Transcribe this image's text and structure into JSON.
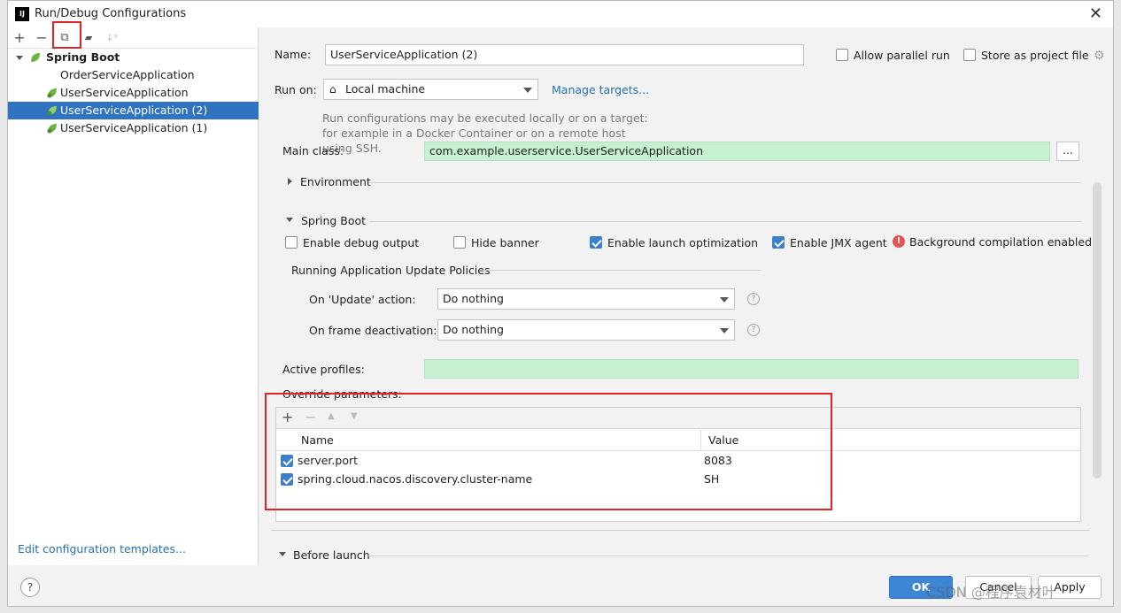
{
  "window": {
    "title": "Run/Debug Configurations",
    "logo_text": "IJ"
  },
  "toolbar": {
    "add": "+",
    "remove": "−",
    "copy": "⧉",
    "folder": "▰",
    "sort": "↓ᵃ"
  },
  "tree": {
    "group": "Spring Boot",
    "items": [
      "OrderServiceApplication",
      "UserServiceApplication",
      "UserServiceApplication (2)",
      "UserServiceApplication (1)"
    ],
    "selected_index": 2
  },
  "left_footer": {
    "edit_templates": "Edit configuration templates..."
  },
  "form": {
    "name_label": "Name:",
    "name_value": "UserServiceApplication (2)",
    "allow_parallel": "Allow parallel run",
    "store_project_file": "Store as project file",
    "run_on_label": "Run on:",
    "run_on_value": "Local machine",
    "manage_targets": "Manage targets...",
    "run_on_hint": "Run configurations may be executed locally or on a target: for example in a Docker Container or on a remote host using SSH.",
    "main_class_label": "Main class:",
    "main_class_value": "com.example.userservice.UserServiceApplication",
    "dots": "...",
    "environment": "Environment",
    "spring_boot_section": "Spring Boot",
    "enable_debug_output": "Enable debug output",
    "hide_banner": "Hide banner",
    "enable_launch_opt": "Enable launch optimization",
    "enable_jmx": "Enable JMX agent",
    "bg_compilation": "Background compilation enabled",
    "update_policies": "Running Application Update Policies",
    "on_update_label": "On 'Update' action:",
    "on_update_value": "Do nothing",
    "on_frame_label": "On frame deactivation:",
    "on_frame_value": "Do nothing",
    "active_profiles_label": "Active profiles:",
    "active_profiles_value": "",
    "override_label": "Override parameters:",
    "before_launch": "Before launch"
  },
  "params_table": {
    "headers": [
      "Name",
      "Value"
    ],
    "rows": [
      {
        "name": "server.port",
        "value": "8083",
        "checked": true
      },
      {
        "name": "spring.cloud.nacos.discovery.cluster-name",
        "value": "SH",
        "checked": true
      }
    ]
  },
  "buttons": {
    "ok": "OK",
    "cancel": "Cancel",
    "apply": "Apply"
  },
  "watermark": "CSDN @程序袁材叶",
  "help": "?",
  "colors": {
    "accent": "#2f73c1",
    "highlight_box": "#e02424",
    "field_green": "#c6f0cf",
    "link": "#2470b3"
  }
}
